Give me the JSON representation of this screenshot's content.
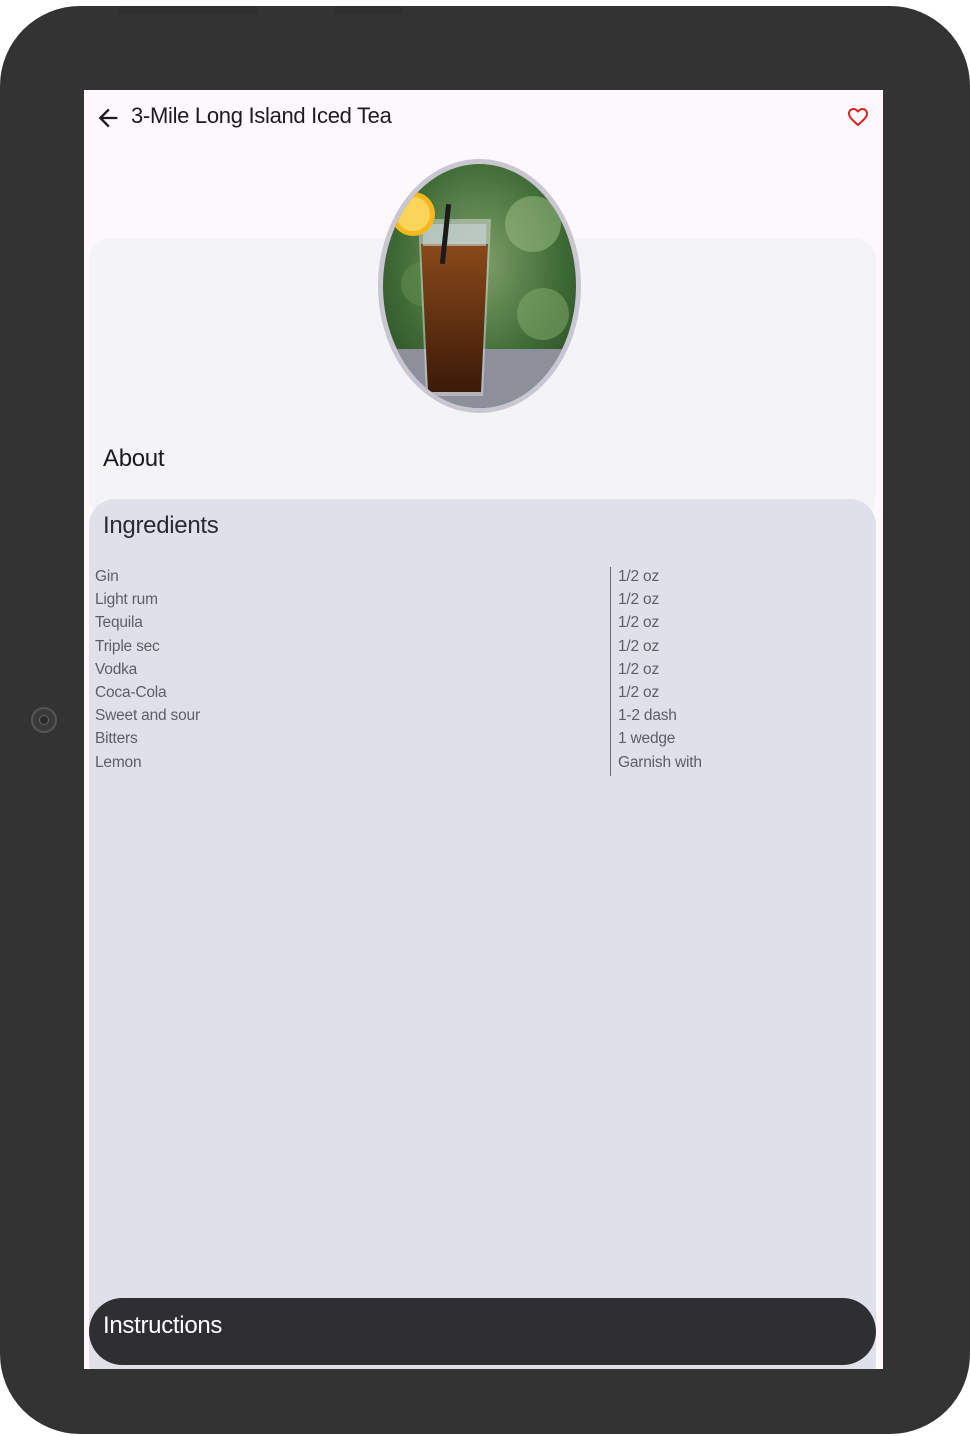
{
  "app": {
    "title": "3-Mile Long Island Iced Tea",
    "back_icon": "arrow-back-icon",
    "favorite_icon": "heart-outline-icon",
    "favorite_color": "#e02020"
  },
  "about": {
    "heading": "About",
    "image_alt": "drink photo"
  },
  "ingredients": {
    "heading": "Ingredients",
    "items": [
      {
        "name": "Gin",
        "measure": "1/2 oz"
      },
      {
        "name": "Light rum",
        "measure": "1/2 oz"
      },
      {
        "name": "Tequila",
        "measure": "1/2 oz"
      },
      {
        "name": "Triple sec",
        "measure": "1/2 oz"
      },
      {
        "name": "Vodka",
        "measure": "1/2 oz"
      },
      {
        "name": "Coca-Cola",
        "measure": "1/2 oz"
      },
      {
        "name": "Sweet and sour",
        "measure": "1-2 dash"
      },
      {
        "name": "Bitters",
        "measure": "1 wedge"
      },
      {
        "name": "Lemon",
        "measure": "Garnish with"
      }
    ]
  },
  "instructions": {
    "label": "Instructions"
  },
  "colors": {
    "screen_bg": "#fcf8fc",
    "card_bg": "#f4f3f8",
    "ingredients_bg": "#e0e0ea",
    "instructions_bg": "#2f2f33",
    "frame": "#333333"
  }
}
